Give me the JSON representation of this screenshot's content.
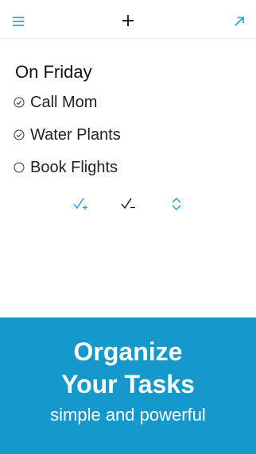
{
  "header": {
    "menu_icon": "hamburger-menu-icon",
    "add_icon": "plus-icon",
    "expand_icon": "diagonal-arrow-icon"
  },
  "list": {
    "title": "On Friday",
    "tasks": [
      {
        "label": "Call Mom",
        "done": true
      },
      {
        "label": "Water Plants",
        "done": true
      },
      {
        "label": "Book Flights",
        "done": false
      }
    ]
  },
  "actions": {
    "icons": [
      "check-plus-icon",
      "check-minus-icon",
      "reorder-icon"
    ]
  },
  "banner": {
    "headline_line1": "Organize",
    "headline_line2": "Your Tasks",
    "subtitle": "simple and powerful",
    "bg_color": "#1599cc"
  },
  "colors": {
    "accent": "#1a9bd7",
    "text": "#111111"
  }
}
